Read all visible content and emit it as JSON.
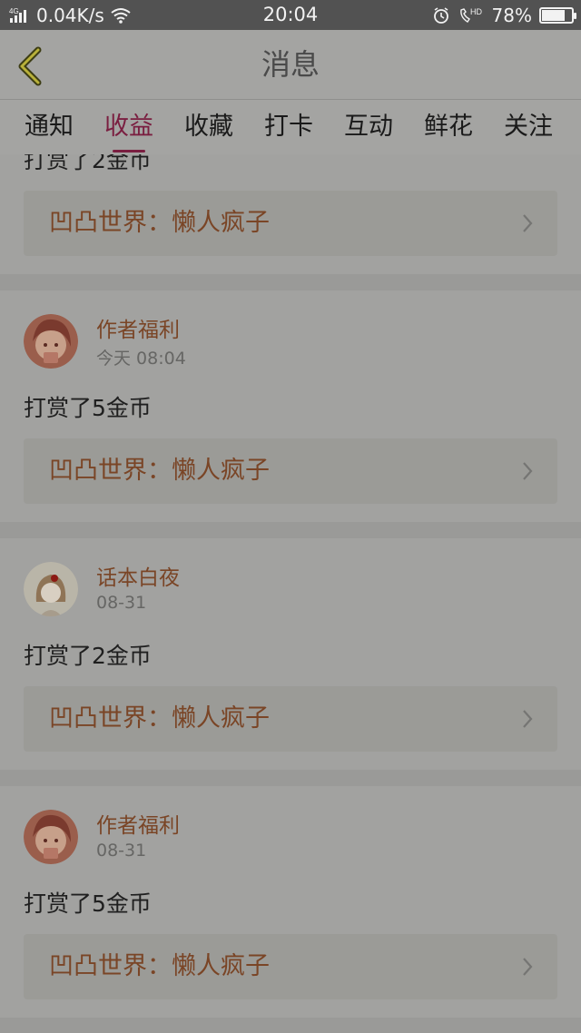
{
  "status_bar": {
    "network": "4G",
    "speed": "0.04K/s",
    "time": "20:04",
    "hd": "HD",
    "battery": "78%",
    "battery_level": 0.78
  },
  "header": {
    "title": "消息"
  },
  "tabs": [
    {
      "label": "通知",
      "active": false
    },
    {
      "label": "收益",
      "active": true
    },
    {
      "label": "收藏",
      "active": false
    },
    {
      "label": "打卡",
      "active": false
    },
    {
      "label": "互动",
      "active": false
    },
    {
      "label": "鲜花",
      "active": false
    },
    {
      "label": "关注",
      "active": false
    }
  ],
  "first_partial": {
    "text": "打赏了2金币",
    "link": "凹凸世界：懒人疯子"
  },
  "messages": [
    {
      "author": "作者福利",
      "time": "今天 08:04",
      "text": "打赏了5金币",
      "link": "凹凸世界：懒人疯子"
    },
    {
      "author": "话本白夜",
      "time": "08-31",
      "text": "打赏了2金币",
      "link": "凹凸世界：懒人疯子"
    },
    {
      "author": "作者福利",
      "time": "08-31",
      "text": "打赏了5金币",
      "link": "凹凸世界：懒人疯子"
    }
  ],
  "colors": {
    "accent": "#7a1e40",
    "link_text": "#7a4526",
    "overlay_bg": "#a2a2a0"
  }
}
